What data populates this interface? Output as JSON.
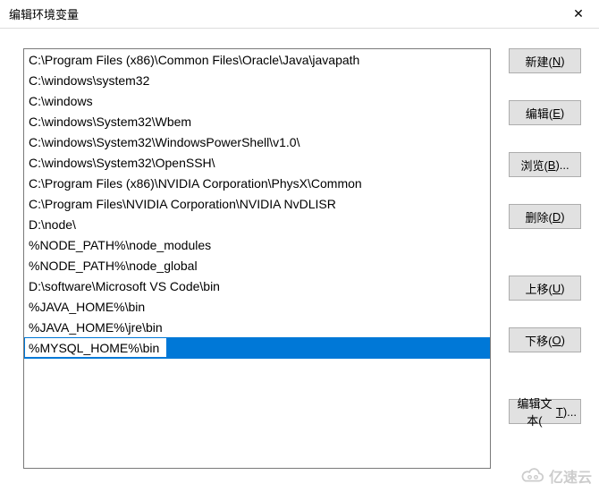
{
  "window": {
    "title": "编辑环境变量"
  },
  "paths": [
    "C:\\Program Files (x86)\\Common Files\\Oracle\\Java\\javapath",
    "C:\\windows\\system32",
    "C:\\windows",
    "C:\\windows\\System32\\Wbem",
    "C:\\windows\\System32\\WindowsPowerShell\\v1.0\\",
    "C:\\windows\\System32\\OpenSSH\\",
    "C:\\Program Files (x86)\\NVIDIA Corporation\\PhysX\\Common",
    "C:\\Program Files\\NVIDIA Corporation\\NVIDIA NvDLISR",
    "D:\\node\\",
    "%NODE_PATH%\\node_modules",
    "%NODE_PATH%\\node_global",
    "D:\\software\\Microsoft VS Code\\bin",
    "%JAVA_HOME%\\bin",
    "%JAVA_HOME%\\jre\\bin"
  ],
  "editing_value": "%MYSQL_HOME%\\bin",
  "buttons": {
    "new": {
      "label": "新建(",
      "hotkey": "N",
      "suffix": ")"
    },
    "edit": {
      "label": "编辑(",
      "hotkey": "E",
      "suffix": ")"
    },
    "browse": {
      "label": "浏览(",
      "hotkey": "B",
      "suffix": ")..."
    },
    "delete": {
      "label": "删除(",
      "hotkey": "D",
      "suffix": ")"
    },
    "moveup": {
      "label": "上移(",
      "hotkey": "U",
      "suffix": ")"
    },
    "movedown": {
      "label": "下移(",
      "hotkey": "O",
      "suffix": ")"
    },
    "edittext": {
      "label": "编辑文本(",
      "hotkey": "T",
      "suffix": ")..."
    }
  },
  "watermark": "亿速云"
}
